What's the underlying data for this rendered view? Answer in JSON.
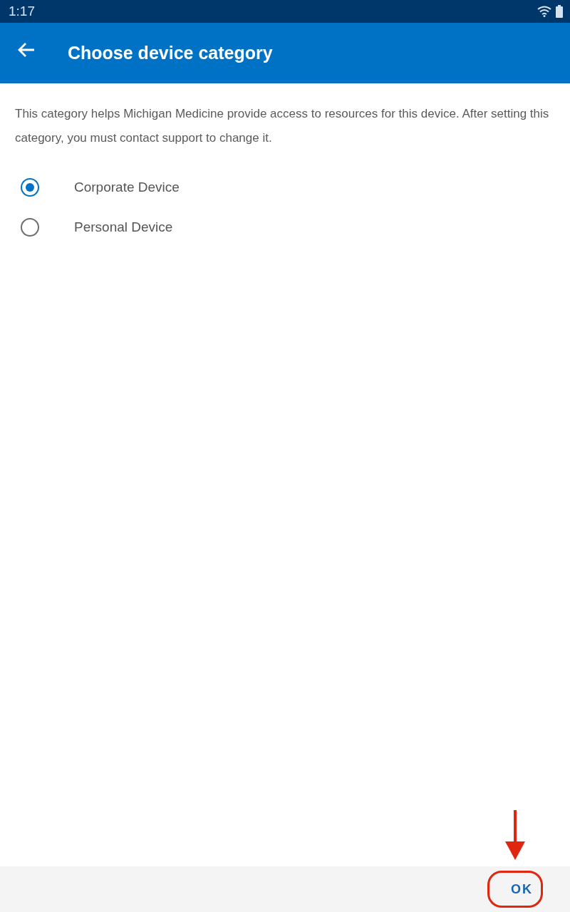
{
  "status_bar": {
    "time": "1:17"
  },
  "app_bar": {
    "title": "Choose device category"
  },
  "description": "This category helps Michigan Medicine provide access to resources for this device. After setting this category, you must contact support to change it.",
  "options": [
    {
      "label": "Corporate Device",
      "selected": true
    },
    {
      "label": "Personal Device",
      "selected": false
    }
  ],
  "footer": {
    "button": "OK"
  }
}
